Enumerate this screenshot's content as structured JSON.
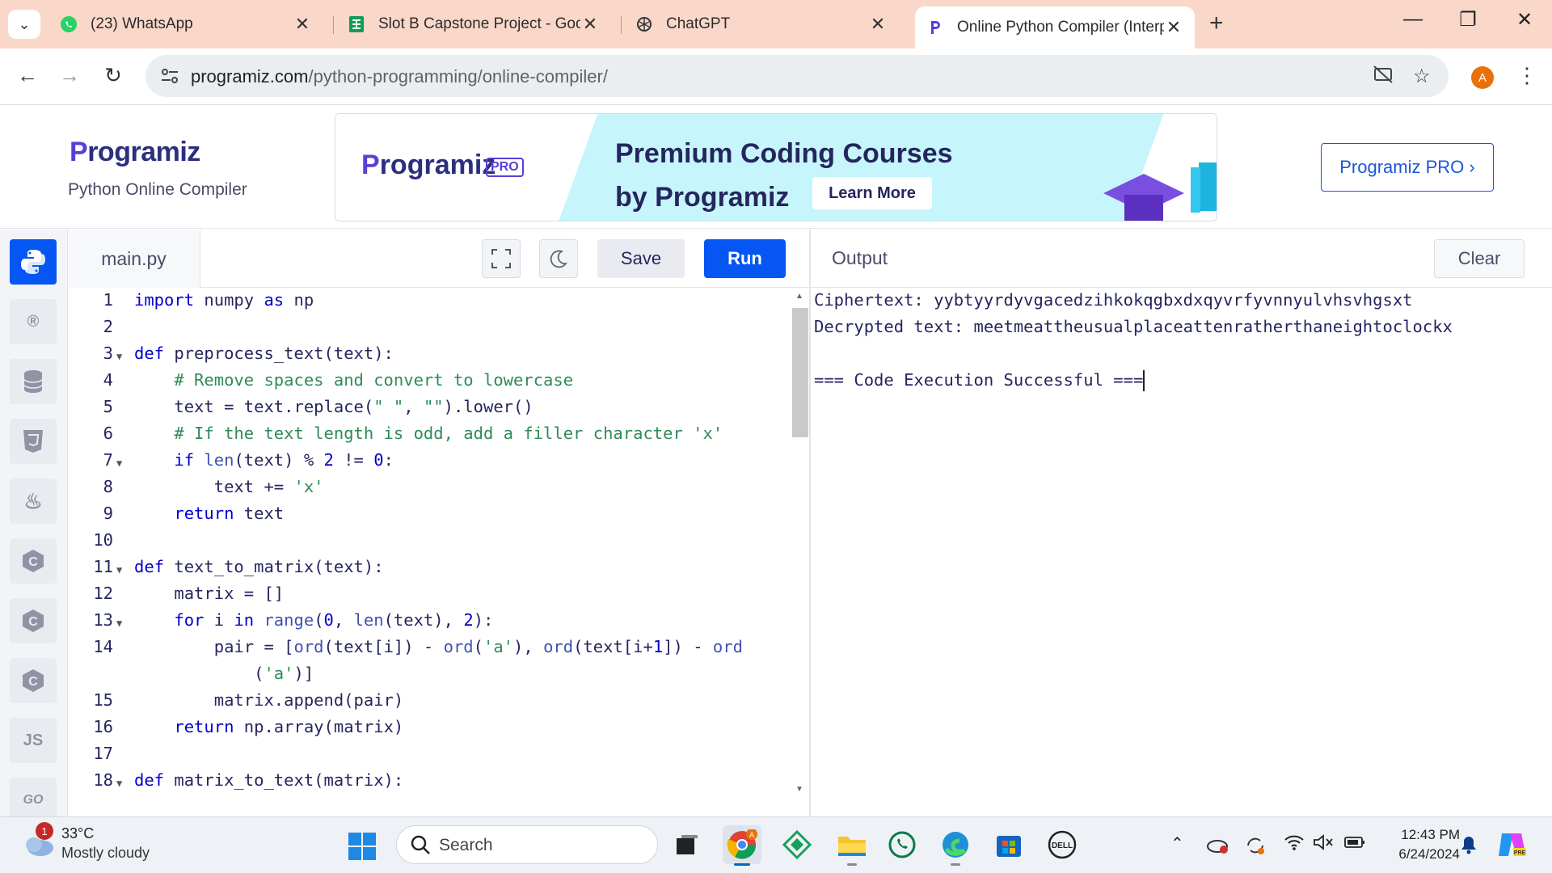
{
  "browser": {
    "tabs": [
      {
        "title": "(23) WhatsApp",
        "icon": "whatsapp-icon"
      },
      {
        "title": "Slot B Capstone Project - Googl",
        "icon": "sheets-icon"
      },
      {
        "title": "ChatGPT",
        "icon": "chatgpt-icon"
      },
      {
        "title": "Online Python Compiler (Interp",
        "icon": "programiz-icon"
      }
    ],
    "url_host": "programiz.com",
    "url_path": "/python-programming/online-compiler/",
    "profile_initial": "A"
  },
  "site": {
    "logo_text": "rogramiz",
    "logo_initial": "P",
    "subtitle": "Python Online Compiler",
    "banner": {
      "logo_initial": "P",
      "logo_text": "rogramiz",
      "pro_badge": "PRO",
      "headline_1": "Premium Coding Courses",
      "headline_2": "by Programiz",
      "cta": "Learn More"
    },
    "pro_button": "Programiz PRO ›"
  },
  "rail": {
    "js_label": "JS",
    "go_label": "GO"
  },
  "editor": {
    "filename": "main.py",
    "save_label": "Save",
    "run_label": "Run",
    "lines": [
      {
        "n": "1",
        "code": "import numpy as np",
        "fold": false
      },
      {
        "n": "2",
        "code": "",
        "fold": false
      },
      {
        "n": "3",
        "code": "def preprocess_text(text):",
        "fold": true
      },
      {
        "n": "4",
        "code": "    # Remove spaces and convert to lowercase",
        "fold": false
      },
      {
        "n": "5",
        "code": "    text = text.replace(\" \", \"\").lower()",
        "fold": false
      },
      {
        "n": "6",
        "code": "    # If the text length is odd, add a filler character 'x'",
        "fold": false
      },
      {
        "n": "7",
        "code": "    if len(text) % 2 != 0:",
        "fold": true
      },
      {
        "n": "8",
        "code": "        text += 'x'",
        "fold": false
      },
      {
        "n": "9",
        "code": "    return text",
        "fold": false
      },
      {
        "n": "10",
        "code": "",
        "fold": false
      },
      {
        "n": "11",
        "code": "def text_to_matrix(text):",
        "fold": true
      },
      {
        "n": "12",
        "code": "    matrix = []",
        "fold": false
      },
      {
        "n": "13",
        "code": "    for i in range(0, len(text), 2):",
        "fold": true
      },
      {
        "n": "14",
        "code": "        pair = [ord(text[i]) - ord('a'), ord(text[i+1]) - ord",
        "fold": false
      },
      {
        "n": "",
        "code": "            ('a')]",
        "fold": false
      },
      {
        "n": "15",
        "code": "        matrix.append(pair)",
        "fold": false
      },
      {
        "n": "16",
        "code": "    return np.array(matrix)",
        "fold": false
      },
      {
        "n": "17",
        "code": "",
        "fold": false
      },
      {
        "n": "18",
        "code": "def matrix_to_text(matrix):",
        "fold": true
      }
    ]
  },
  "output": {
    "label": "Output",
    "clear_label": "Clear",
    "lines": [
      "Ciphertext: yybtyyrdyvgacedzihkokqgbxdxqyvrfyvnnyulvhsvhgsxt",
      "Decrypted text: meetmeattheusualplaceattenratherthaneightoclockx",
      "",
      "=== Code Execution Successful ==="
    ]
  },
  "taskbar": {
    "weather_badge": "1",
    "temperature": "33°C",
    "condition": "Mostly cloudy",
    "search_placeholder": "Search",
    "time": "12:43 PM",
    "date": "6/24/2024"
  },
  "colors": {
    "accent": "#0556f3",
    "brand": "#2b2f7e",
    "tabstrip": "#f9d8c9"
  }
}
